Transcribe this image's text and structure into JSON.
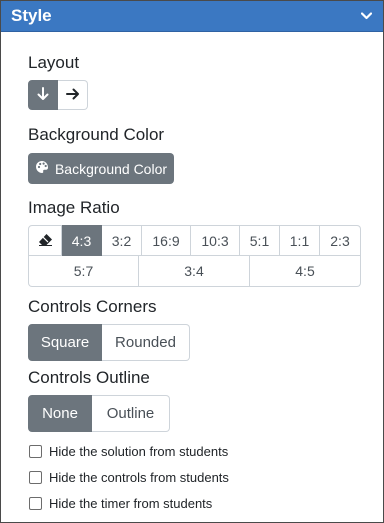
{
  "header": {
    "title": "Style"
  },
  "layout": {
    "title": "Layout",
    "options": [
      {
        "icon": "arrow-down-icon",
        "glyph": "↓",
        "active": true
      },
      {
        "icon": "arrow-right-icon",
        "glyph": "→",
        "active": false
      }
    ]
  },
  "background": {
    "title": "Background Color",
    "button_label": "Background Color",
    "button_icon": "palette-icon"
  },
  "image_ratio": {
    "title": "Image Ratio",
    "eraser_icon": "eraser-icon",
    "row1": [
      "4:3",
      "3:2",
      "16:9",
      "10:3",
      "5:1",
      "1:1",
      "2:3"
    ],
    "row2": [
      "5:7",
      "3:4",
      "4:5"
    ],
    "selected": "4:3"
  },
  "controls_corners": {
    "title": "Controls Corners",
    "options": [
      "Square",
      "Rounded"
    ],
    "selected": "Square"
  },
  "controls_outline": {
    "title": "Controls Outline",
    "options": [
      "None",
      "Outline"
    ],
    "selected": "None"
  },
  "checkboxes": [
    {
      "label": "Hide the solution from students",
      "checked": false
    },
    {
      "label": "Hide the controls from students",
      "checked": false
    },
    {
      "label": "Hide the timer from students",
      "checked": false
    }
  ],
  "colors": {
    "header_bg": "#3b78c2",
    "active_bg": "#6c757d",
    "border": "#ced4da"
  }
}
